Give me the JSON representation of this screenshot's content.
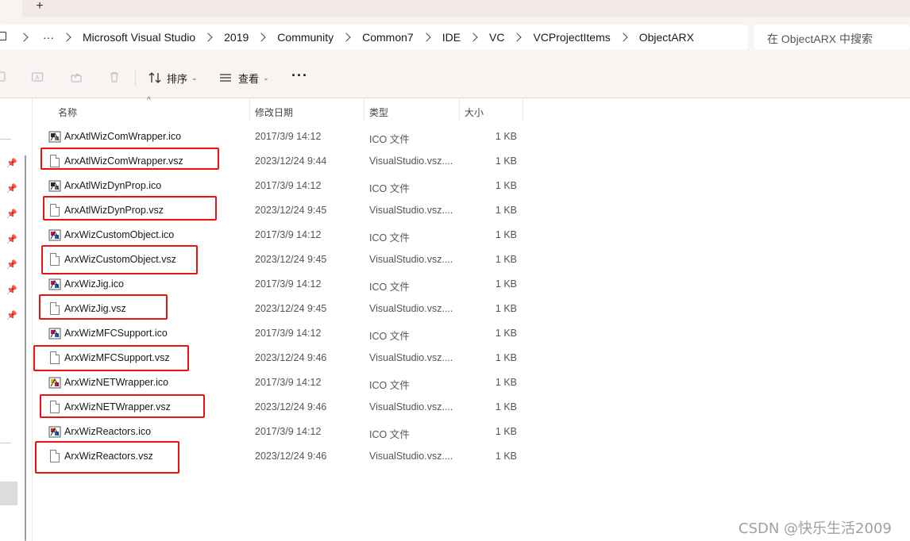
{
  "tabs": {
    "new_tab_glyph": "+"
  },
  "breadcrumb": {
    "overflow": "···",
    "items": [
      "Microsoft Visual Studio",
      "2019",
      "Community",
      "Common7",
      "IDE",
      "VC",
      "VCProjectItems",
      "ObjectARX"
    ]
  },
  "search": {
    "placeholder": "在 ObjectARX 中搜索"
  },
  "commands": {
    "sort_label": "排序",
    "view_label": "查看",
    "more_label": "···"
  },
  "columns": {
    "name": "名称",
    "date": "修改日期",
    "type": "类型",
    "size": "大小"
  },
  "files": [
    {
      "name": "ArxAtlWizComWrapper.ico",
      "date": "2017/3/9 14:12",
      "type": "ICO 文件",
      "size": "1 KB",
      "icon": "ico-file-icon",
      "highlighted": false
    },
    {
      "name": "ArxAtlWizComWrapper.vsz",
      "date": "2023/12/24 9:44",
      "type": "VisualStudio.vsz....",
      "size": "1 KB",
      "icon": "document-icon",
      "highlighted": true
    },
    {
      "name": "ArxAtlWizDynProp.ico",
      "date": "2017/3/9 14:12",
      "type": "ICO 文件",
      "size": "1 KB",
      "icon": "ico-file-icon",
      "highlighted": false
    },
    {
      "name": "ArxAtlWizDynProp.vsz",
      "date": "2023/12/24 9:45",
      "type": "VisualStudio.vsz....",
      "size": "1 KB",
      "icon": "document-icon",
      "highlighted": true
    },
    {
      "name": "ArxWizCustomObject.ico",
      "date": "2017/3/9 14:12",
      "type": "ICO 文件",
      "size": "1 KB",
      "icon": "ico-file-icon",
      "highlighted": false
    },
    {
      "name": "ArxWizCustomObject.vsz",
      "date": "2023/12/24 9:45",
      "type": "VisualStudio.vsz....",
      "size": "1 KB",
      "icon": "document-icon",
      "highlighted": true
    },
    {
      "name": "ArxWizJig.ico",
      "date": "2017/3/9 14:12",
      "type": "ICO 文件",
      "size": "1 KB",
      "icon": "ico-file-icon",
      "highlighted": false
    },
    {
      "name": "ArxWizJig.vsz",
      "date": "2023/12/24 9:45",
      "type": "VisualStudio.vsz....",
      "size": "1 KB",
      "icon": "document-icon",
      "highlighted": true
    },
    {
      "name": "ArxWizMFCSupport.ico",
      "date": "2017/3/9 14:12",
      "type": "ICO 文件",
      "size": "1 KB",
      "icon": "ico-file-icon",
      "highlighted": false
    },
    {
      "name": "ArxWizMFCSupport.vsz",
      "date": "2023/12/24 9:46",
      "type": "VisualStudio.vsz....",
      "size": "1 KB",
      "icon": "document-icon",
      "highlighted": true
    },
    {
      "name": "ArxWizNETWrapper.ico",
      "date": "2017/3/9 14:12",
      "type": "ICO 文件",
      "size": "1 KB",
      "icon": "ico-file-icon",
      "highlighted": false
    },
    {
      "name": "ArxWizNETWrapper.vsz",
      "date": "2023/12/24 9:46",
      "type": "VisualStudio.vsz....",
      "size": "1 KB",
      "icon": "document-icon",
      "highlighted": true
    },
    {
      "name": "ArxWizReactors.ico",
      "date": "2017/3/9 14:12",
      "type": "ICO 文件",
      "size": "1 KB",
      "icon": "ico-file-icon",
      "highlighted": false
    },
    {
      "name": "ArxWizReactors.vsz",
      "date": "2023/12/24 9:46",
      "type": "VisualStudio.vsz....",
      "size": "1 KB",
      "icon": "document-icon",
      "highlighted": true
    }
  ],
  "watermark": "CSDN @快乐生活2009",
  "colors": {
    "highlight": "#e11111",
    "chrome_bg": "#f9f3f1",
    "tab_bg": "#f3e9e6"
  }
}
